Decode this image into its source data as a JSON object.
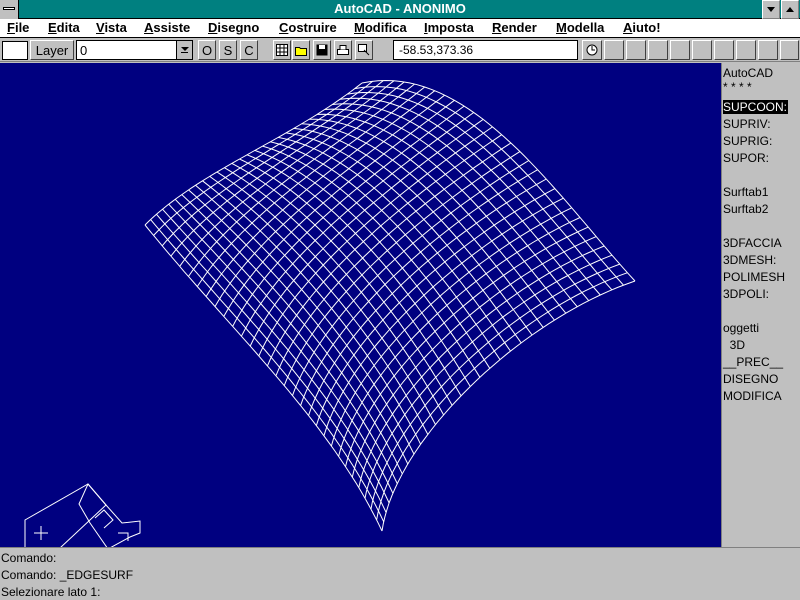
{
  "window": {
    "title": "AutoCAD - ANONIMO"
  },
  "menubar": {
    "items": [
      "File",
      "Edita",
      "Vista",
      "Assiste",
      "Disegno",
      "Costruire",
      "Modifica",
      "Imposta",
      "Render",
      "Modella",
      "Aiuto!"
    ]
  },
  "toolbar": {
    "layer_label": "Layer",
    "layer_value": "0",
    "ortho_label": "O",
    "snap_label": "S",
    "coords_toggle_label": "C",
    "coordinates": "-58.53,373.36"
  },
  "sidemenu": {
    "items": [
      "AutoCAD",
      "* * * *",
      "SUPCOON:",
      "SUPRIV:",
      "SUPRIG:",
      "SUPOR:",
      "",
      "Surftab1",
      "Surftab2",
      "",
      "3DFACCIA",
      "3DMESH:",
      "POLIMESH",
      "3DPOLI:",
      "",
      "oggetti",
      "  3D",
      "__PREC__",
      "DISEGNO",
      "MODIFICA"
    ],
    "highlighted_index": 2
  },
  "command": {
    "lines": [
      "Comando:",
      "Comando: _EDGESURF",
      "Selezionare lato 1:"
    ]
  },
  "colors": {
    "canvas": "#000080",
    "titlebar": "#008080",
    "chrome": "#c0c0c0",
    "wireframe": "#ffffff"
  },
  "icons": [
    "system-menu-icon",
    "minimize-icon",
    "maximize-icon",
    "dropdown-arrow-icon",
    "grid-icon",
    "open-folder-icon",
    "save-disk-icon",
    "print-icon",
    "render-icon",
    "coordinate-icon",
    "ucs-icon"
  ]
}
